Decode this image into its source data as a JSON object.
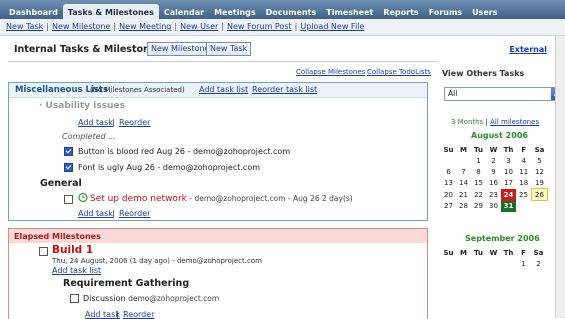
{
  "nav": {
    "tabs": [
      "Dashboard",
      "Tasks & Milestones",
      "Calendar",
      "Meetings",
      "Documents",
      "Timesheet",
      "Reports",
      "Forums",
      "Users"
    ],
    "active": "Tasks & Milestones"
  },
  "subnav": [
    "New Task",
    "New Milestone",
    "New Meeting",
    "New User",
    "New Forum Post",
    "Upload New File"
  ],
  "header": {
    "title": "Internal Tasks & Milestones",
    "new_milestone_btn": "New Milestone",
    "new_task_btn": "New Task",
    "external_link": "External"
  },
  "collapse": {
    "milestones": "Collapse Milestones",
    "todolists": "Collapse TodoLists"
  },
  "misc": {
    "title": "Miscellaneous Lists",
    "note": "(No Milestones Associated)",
    "add_task_list": "Add task list",
    "reorder_task_list": "Reorder task list",
    "section_title": "· Usability issues",
    "add_task": "Add task",
    "reorder": "Reorder",
    "pipe": "|",
    "completed_label": "Completed ...",
    "completed_tasks": [
      {
        "text": "Button is blood red",
        "date": "Aug 26",
        "owner": "- demo@zohoproject.com"
      },
      {
        "text": "Font is ugly",
        "date": "Aug 26",
        "owner": "- demo@zohoproject.com"
      }
    ],
    "general_title": "General",
    "general_task": {
      "text": "Set up demo network",
      "meta": "- demo@zohoproject.com - Aug 26 2 day(s)"
    }
  },
  "elapsed": {
    "title": "Elapsed Milestones",
    "milestone": "Build 1",
    "date_line": "Thu, 24 August, 2006 (1 day ago) - demo@zohoproject.com",
    "add_task_list": "Add task list",
    "section": "Requirement Gathering",
    "task": {
      "text": "Discussion",
      "owner": "demo@zohoproject.com"
    },
    "add_task": "Add task",
    "reorder": "Reorder"
  },
  "sidebar": {
    "title": "View Others Tasks",
    "select_value": "All",
    "months_link": "3 Months",
    "all_link": "All milestones",
    "aug_title": "August 2006",
    "sep_title": "September 2006",
    "weekdays": [
      "Su",
      "M",
      "Tu",
      "W",
      "Th",
      "F",
      "Sa"
    ],
    "aug_rows": [
      [
        "",
        "",
        "1",
        "2",
        "3",
        "4",
        "5"
      ],
      [
        "6",
        "7",
        "8",
        "9",
        "10",
        "11",
        "12"
      ],
      [
        "13",
        "14",
        "15",
        "16",
        "17",
        "18",
        "19"
      ],
      [
        "20",
        "21",
        "22",
        "23",
        "24",
        "25",
        "26"
      ],
      [
        "27",
        "28",
        "29",
        "30",
        "31",
        "",
        ""
      ]
    ],
    "sep_rows": [
      [
        "",
        "",
        "",
        "",
        "",
        "1",
        "2"
      ]
    ]
  },
  "colors": {
    "nav": "#3e6288",
    "today": "#cc1d1d",
    "cal_title": "#2f8a2f",
    "elapsed_head": "#fbd9d9",
    "task_red": "#d20d0d"
  }
}
